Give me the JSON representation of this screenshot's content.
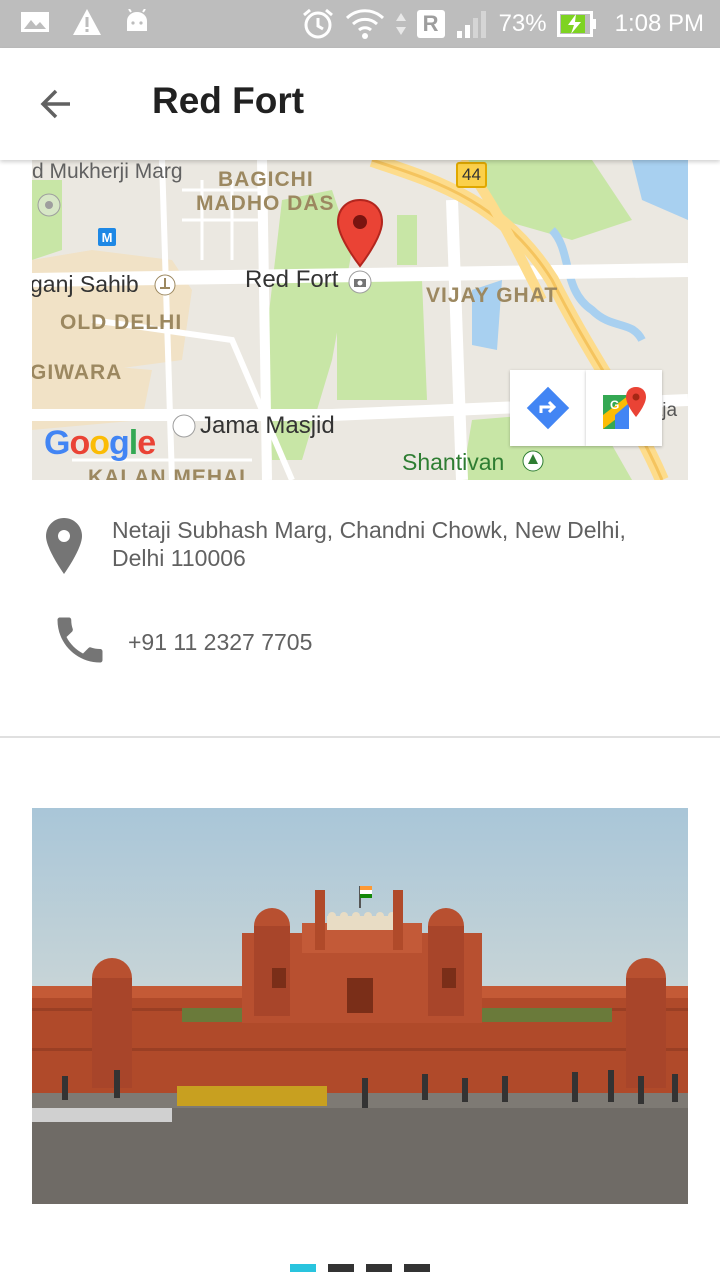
{
  "status_bar": {
    "battery_percent": "73%",
    "time": "1:08 PM",
    "network_badge": "R"
  },
  "header": {
    "title": "Red Fort"
  },
  "map": {
    "pin_label": "Red Fort",
    "labels": [
      "d Mukherji Marg",
      "BAGICHI",
      "MADHO DAS",
      "44",
      "ganj Sahib",
      "OLD DELHI",
      "VIJAY GHAT",
      "GIWARA",
      "Jama Masjid",
      "Shantivan",
      "KALAN MEHAL",
      "Raja"
    ],
    "google_logo": "Google",
    "directions_icon": "directions-icon",
    "open_maps_icon": "google-maps-icon"
  },
  "place": {
    "address": "Netaji Subhash Marg, Chandni Chowk, New Delhi, Delhi 110006",
    "phone": "+91 11 2327 7705"
  },
  "carousel": {
    "slide_count": 4,
    "active_index": 0,
    "colors": {
      "active": "#29c4de",
      "inactive": "#333333"
    }
  }
}
